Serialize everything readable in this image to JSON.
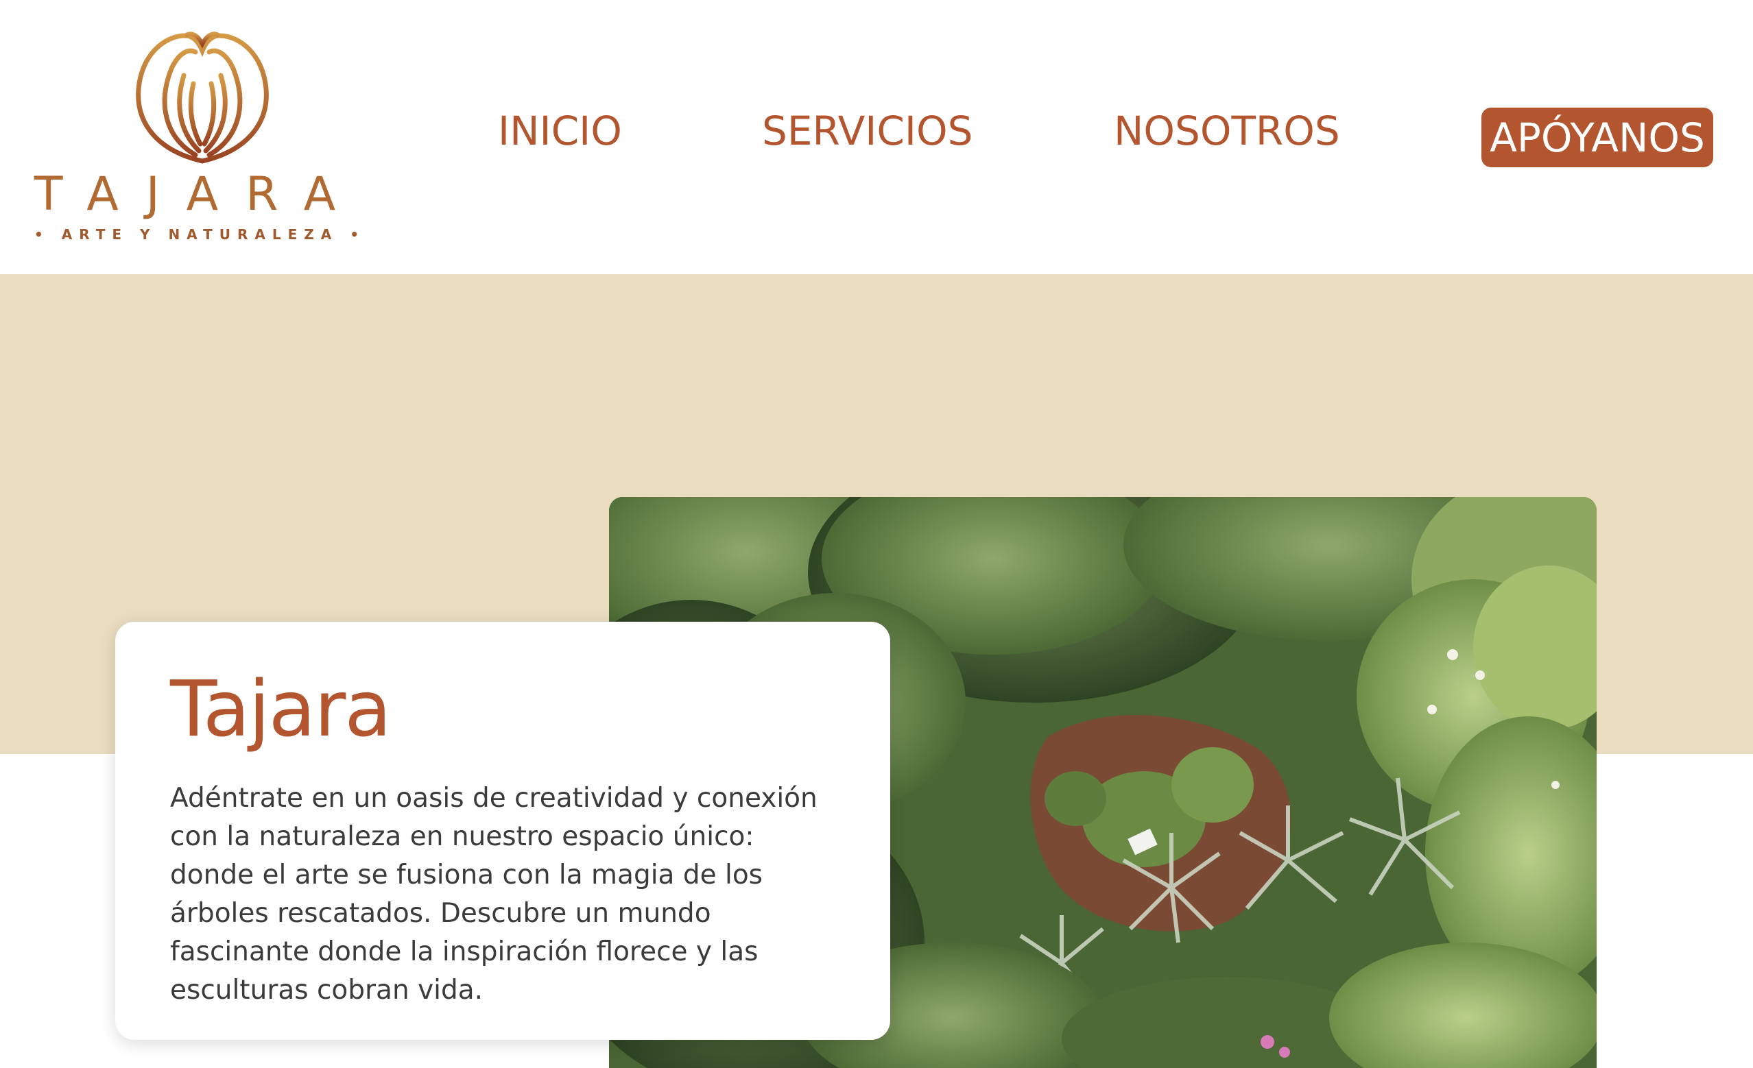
{
  "brand": {
    "name": "TAJARA",
    "tagline": "• ARTE Y NATURALEZA •",
    "primary_color": "#b3552e",
    "logo_gradient": [
      "#d49a45",
      "#9a4322"
    ]
  },
  "nav": {
    "items": [
      {
        "label": "INICIO"
      },
      {
        "label": "SERVICIOS"
      },
      {
        "label": "NOSOTROS"
      }
    ],
    "cta_label": "APÓYANOS"
  },
  "hero": {
    "title": "Tajara",
    "description": "Adéntrate en un oasis de creatividad y conexión con la naturaleza en nuestro espacio único: donde el arte se fusiona con la magia de los árboles rescatados. Descubre un mundo fascinante donde la inspiración florece y las esculturas cobran vida.",
    "background_color": "#e9dcbf",
    "photo": "aerial-garden-photo"
  }
}
